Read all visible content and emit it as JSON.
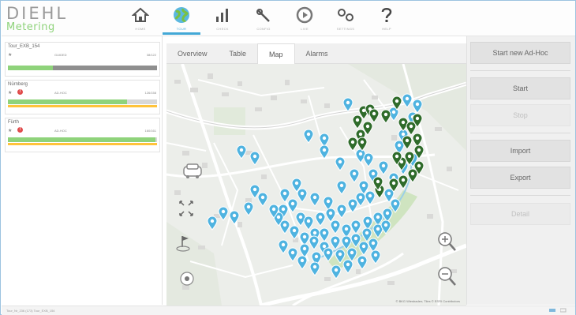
{
  "app": {
    "logo_main": "DIEHL",
    "logo_sub": "Metering"
  },
  "nav": [
    {
      "name": "nav-home",
      "icon": "home-icon",
      "label": "HOME",
      "active": false
    },
    {
      "name": "nav-tour",
      "icon": "globe-icon",
      "label": "TOUR",
      "active": true
    },
    {
      "name": "nav-check",
      "icon": "bar-chart-icon",
      "label": "CHECK",
      "active": false
    },
    {
      "name": "nav-config",
      "icon": "wrench-icon",
      "label": "CONFIG",
      "active": false
    },
    {
      "name": "nav-live",
      "icon": "play-icon",
      "label": "LIVE",
      "active": false
    },
    {
      "name": "nav-settings",
      "icon": "settings-icon",
      "label": "SETTINGS",
      "active": false
    },
    {
      "name": "nav-help",
      "icon": "help-icon",
      "label": "HELP",
      "active": false
    }
  ],
  "tours": [
    {
      "title": "Tour_EXB_154",
      "mode": "GUIDED",
      "count": "38/122",
      "progress": 0.3,
      "warning": false
    },
    {
      "title": "Nürnberg",
      "mode": "AD-HOC",
      "count": "126/158",
      "progress": 0.8,
      "warning": true
    },
    {
      "title": "Fürth",
      "mode": "AD-HOC",
      "count": "160/161",
      "progress": 0.99,
      "warning": true
    }
  ],
  "tabs": [
    {
      "label": "Overview",
      "active": false
    },
    {
      "label": "Table",
      "active": false
    },
    {
      "label": "Map",
      "active": true
    },
    {
      "label": "Alarms",
      "active": false
    }
  ],
  "actions": {
    "start_new": "Start new Ad-Hoc",
    "start": "Start",
    "stop": "Stop",
    "import": "Import",
    "export": "Export",
    "detail": "Detail"
  },
  "map": {
    "attribution": "© BKG Wiesbaden; Tiles © ESRI Contributors",
    "colors": {
      "read": "#2f6b2a",
      "unread": "#4fb3e0",
      "water": "#7fc7e6",
      "park": "#cfe4c0"
    }
  },
  "status": {
    "text": "Tour_Nr_236 (173) Tour_EXB_154"
  }
}
